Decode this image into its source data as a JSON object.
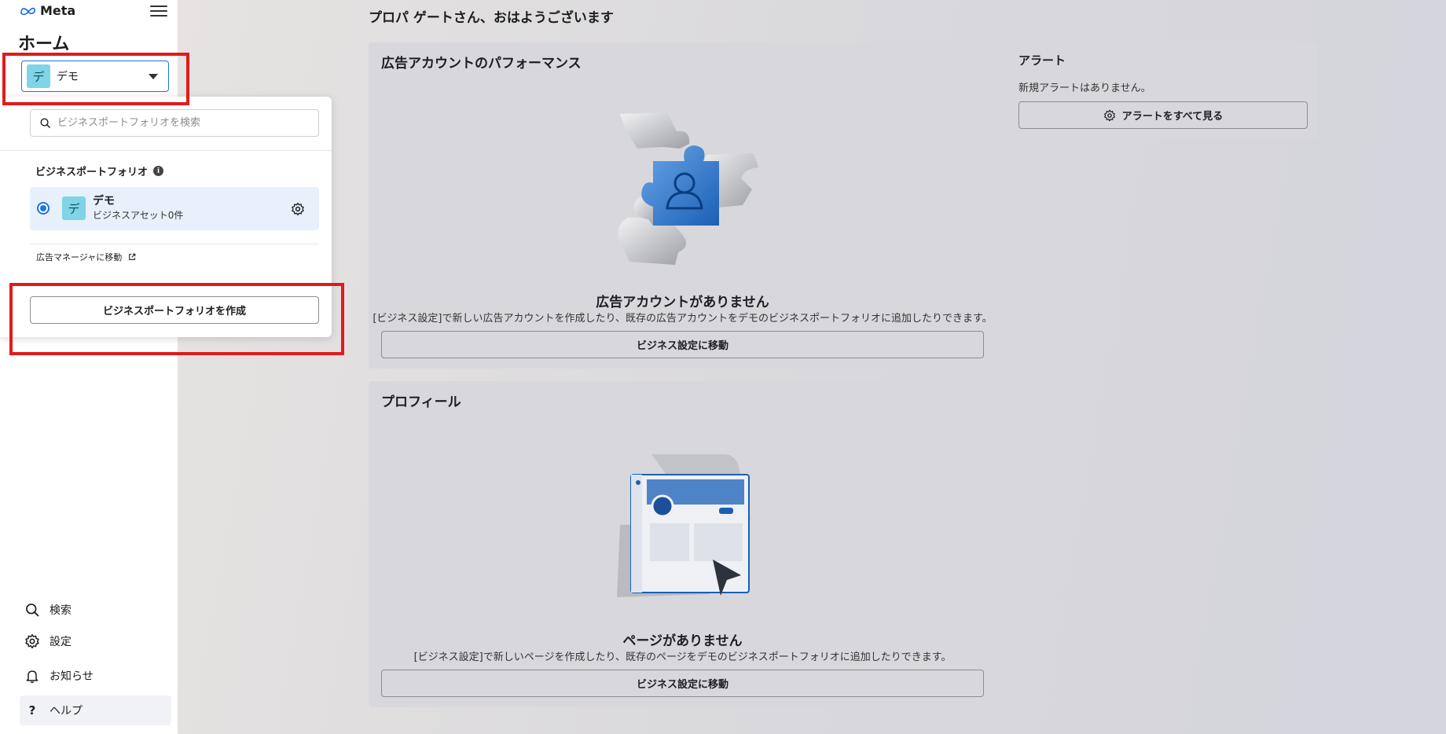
{
  "brand": {
    "logo_text": "Meta"
  },
  "sidebar": {
    "home_title": "ホーム",
    "selector": {
      "initial": "デ",
      "name": "デモ"
    },
    "nav": [
      {
        "label": "検索",
        "icon": "search-icon"
      },
      {
        "label": "設定",
        "icon": "gear-icon"
      },
      {
        "label": "お知らせ",
        "icon": "bell-icon"
      },
      {
        "label": "ヘルプ",
        "icon": "question-icon"
      }
    ]
  },
  "dropdown": {
    "search_placeholder": "ビジネスポートフォリオを検索",
    "section_title": "ビジネスポートフォリオ",
    "portfolio": {
      "initial": "デ",
      "name": "デモ",
      "subtitle": "ビジネスアセット0件",
      "selected": true
    },
    "ads_manager_link": "広告マネージャに移動",
    "create_button": "ビジネスポートフォリオを作成"
  },
  "main": {
    "greeting": "プロパ ゲートさん、おはようございます",
    "ad_performance": {
      "title": "広告アカウントのパフォーマンス",
      "empty_title": "広告アカウントがありません",
      "empty_desc": "[ビジネス設定]で新しい広告アカウントを作成したり、既存の広告アカウントをデモのビジネスポートフォリオに追加したりできます。",
      "button": "ビジネス設定に移動"
    },
    "profile": {
      "title": "プロフィール",
      "empty_title": "ページがありません",
      "empty_desc": "[ビジネス設定]で新しいページを作成したり、既存のページをデモのビジネスポートフォリオに追加したりできます。",
      "button": "ビジネス設定に移動"
    },
    "alerts": {
      "title": "アラート",
      "text": "新規アラートはありません。",
      "button": "アラートをすべて見る"
    }
  },
  "colors": {
    "accent": "#1b74e4",
    "highlight_box": "#e01b1b",
    "avatar": "#7fd4e6",
    "selected_row": "#e7f0fb"
  }
}
